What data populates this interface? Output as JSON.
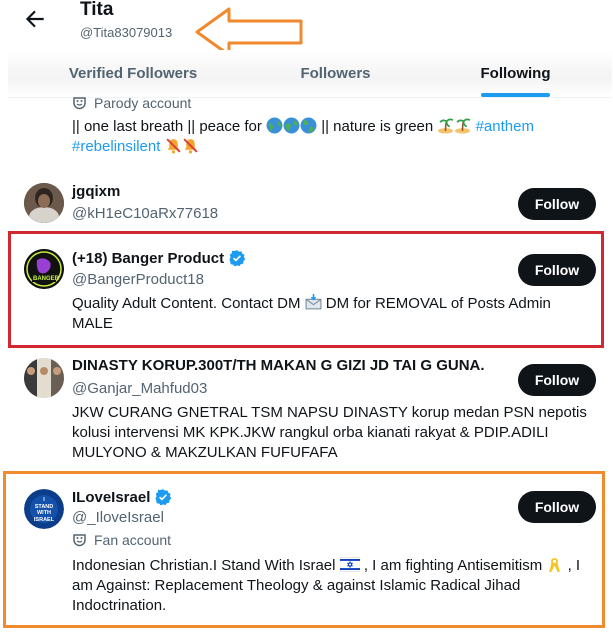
{
  "header": {
    "title": "Tita",
    "handle": "@Tita83079013"
  },
  "tabs": [
    {
      "label": "Verified Followers",
      "active": false
    },
    {
      "label": "Followers",
      "active": false
    },
    {
      "label": "Following",
      "active": true
    }
  ],
  "colors": {
    "accent": "#1d9bf0",
    "highlight_red": "#d22630",
    "highlight_orange": "#f08a2c",
    "follow_button": "#0f1419"
  },
  "users": [
    {
      "label": "Parody account",
      "label_icon": "theater-masks-icon",
      "bio_text": "|| one last breath || peace for",
      "bio_text_2": "|| nature is green",
      "bio_tag_1": "#anthem",
      "bio_tag_2": "#rebelinsilent"
    },
    {
      "name": "jgqixm",
      "handle": "@kH1eC10aRx77618",
      "follow_label": "Follow"
    },
    {
      "name": "(+18) Banger Product",
      "verified": true,
      "handle": "@BangerProduct18",
      "bio_line_1_a": "Quality Adult Content. Contact DM",
      "bio_line_1_b": "DM for REMOVAL of Posts Admin",
      "bio_line_2": "MALE",
      "follow_label": "Follow",
      "avatar_text": "BANGER"
    },
    {
      "name": "DINASTY KORUP.300T/TH MAKAN G GIZI JD TAI G GUNA.",
      "handle": "@Ganjar_Mahfud03",
      "bio_line_1": "JKW CURANG GNETRAL TSM NAPSU DINASTY korup medan PSN nepotis",
      "bio_line_2": "kolusi intervensi MK KPK.JKW rangkul orba kianati rakyat & PDIP.ADILI",
      "bio_line_3": "MULYONO & MAKZULKAN FUFUFAFA",
      "follow_label": "Follow"
    },
    {
      "name": "ILoveIsrael",
      "verified": true,
      "handle": "@_IloveIsrael",
      "label": "Fan account",
      "label_icon": "theater-masks-icon",
      "bio_line_1_a": "Indonesian Christian.I Stand With Israel",
      "bio_line_1_b": ", I am fighting Antisemitism",
      "bio_line_1_c": ", I",
      "bio_line_2": "am Against: Replacement Theology & against Islamic Radical Jihad",
      "bio_line_3": "Indoctrination.",
      "follow_label": "Follow",
      "avatar_text_1": "I",
      "avatar_text_2": "STAND",
      "avatar_text_3": "WITH",
      "avatar_text_4": "ISRAEL"
    }
  ]
}
